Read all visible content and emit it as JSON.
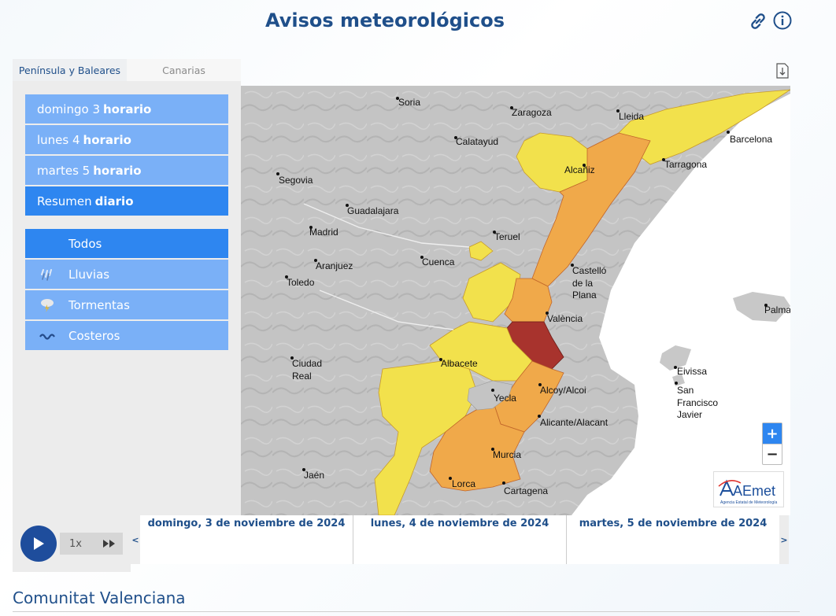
{
  "header": {
    "title": "Avisos meteorológicos",
    "link_icon": "link-icon",
    "info_icon": "info-icon"
  },
  "tabs": [
    {
      "label": "Península y Baleares",
      "active": true
    },
    {
      "label": "Canarias",
      "active": false
    }
  ],
  "periods": [
    {
      "day": "domingo 3",
      "mode": "horario",
      "active": false
    },
    {
      "day": "lunes 4",
      "mode": "horario",
      "active": false
    },
    {
      "day": "martes 5",
      "mode": "horario",
      "active": false
    },
    {
      "day": "Resumen",
      "mode": "diario",
      "active": true
    }
  ],
  "filters": [
    {
      "label": "Todos",
      "icon": "",
      "active": true
    },
    {
      "label": "Lluvias",
      "icon": "rain-icon",
      "active": false
    },
    {
      "label": "Tormentas",
      "icon": "storm-icon",
      "active": false
    },
    {
      "label": "Costeros",
      "icon": "waves-icon",
      "active": false
    }
  ],
  "map": {
    "cities": [
      "Soria",
      "Zaragoza",
      "Lleida",
      "Barcelona",
      "Calatayud",
      "Alcañiz",
      "Tarragona",
      "Segovia",
      "Guadalajara",
      "Madrid",
      "Teruel",
      "Aranjuez",
      "Cuenca",
      "Toledo",
      "Castelló\nde la\nPlana",
      "València",
      "Palma",
      "Ciudad\nReal",
      "Albacete",
      "Eivissa",
      "Alcoy/Alcoi",
      "Yecla",
      "San\nFrancisco\nJavier",
      "Alicante/Alacant",
      "Murcia",
      "Jaén",
      "Lorca",
      "Cartagena"
    ],
    "zoom_in": "+",
    "zoom_out": "−",
    "logo_text": "AEmet",
    "logo_subtitle": "Agencia Estatal de Meteorología",
    "colors": {
      "yellow": "#f2e14c",
      "orange": "#f0a94a",
      "red": "#a8332d",
      "land": "#c6c6c6",
      "sea": "#ffffff"
    }
  },
  "timeline": {
    "speed": "1x",
    "prev": "<",
    "next": ">",
    "days": [
      "domingo, 3 de noviembre de 2024",
      "lunes, 4 de noviembre de 2024",
      "martes, 5 de noviembre de 2024"
    ]
  },
  "region": {
    "title": "Comunitat Valenciana"
  }
}
